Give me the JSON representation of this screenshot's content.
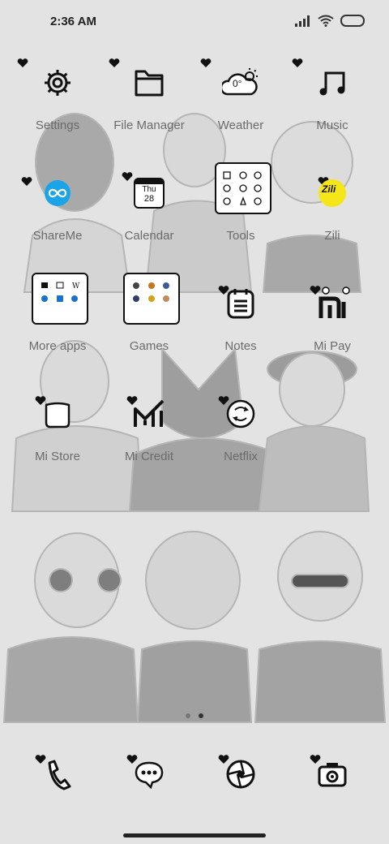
{
  "status_bar": {
    "time": "2:36 AM",
    "signal_icon": "signal-bars-icon",
    "wifi_icon": "wifi-icon",
    "battery_icon": "battery-icon"
  },
  "apps": [
    {
      "label": "Settings",
      "icon": "gear-icon"
    },
    {
      "label": "File Manager",
      "icon": "folder-icon"
    },
    {
      "label": "Weather",
      "icon": "weather-cloud-icon",
      "temp": "0°"
    },
    {
      "label": "Music",
      "icon": "music-note-icon"
    },
    {
      "label": "ShareMe",
      "icon": "shareme-icon"
    },
    {
      "label": "Calendar",
      "icon": "calendar-icon",
      "day": "Thu",
      "date": "28"
    },
    {
      "label": "Tools",
      "icon": "tools-folder-icon"
    },
    {
      "label": "Zili",
      "icon": "zili-icon",
      "brand": "Zili"
    },
    {
      "label": "More apps",
      "icon": "more-apps-folder-icon"
    },
    {
      "label": "Games",
      "icon": "games-folder-icon"
    },
    {
      "label": "Notes",
      "icon": "notes-icon"
    },
    {
      "label": "Mi Pay",
      "icon": "mi-pay-icon"
    },
    {
      "label": "Mi Store",
      "icon": "mi-store-icon"
    },
    {
      "label": "Mi Credit",
      "icon": "mi-credit-icon"
    },
    {
      "label": "Netflix",
      "icon": "netflix-icon"
    }
  ],
  "dock": [
    {
      "name": "phone",
      "icon": "phone-icon"
    },
    {
      "name": "messages",
      "icon": "message-bubble-icon"
    },
    {
      "name": "browser",
      "icon": "browser-aperture-icon"
    },
    {
      "name": "camera",
      "icon": "camera-icon"
    }
  ],
  "page_indicator": {
    "count": 2,
    "active": 2
  },
  "colors": {
    "background": "#e3e3e3",
    "label": "#6b6b6b",
    "icon": "#111111",
    "shareme": "#1ba4e8",
    "zili": "#f5e61a"
  }
}
